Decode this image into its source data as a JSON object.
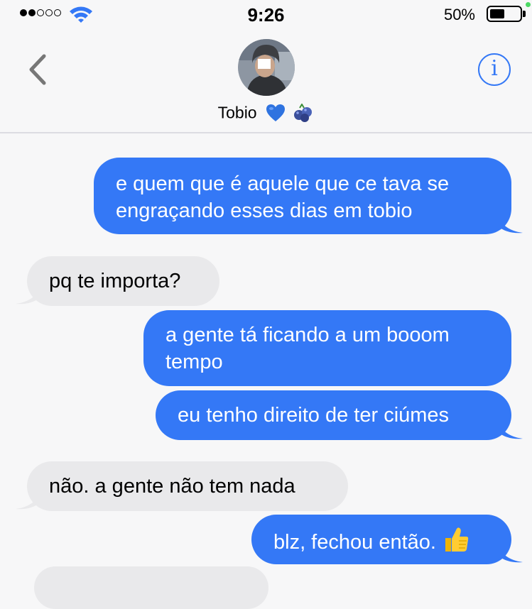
{
  "status_bar": {
    "time": "9:26",
    "battery_percent": "50%",
    "signal_bars": 2,
    "signal_total": 5,
    "battery_level": 0.5
  },
  "header": {
    "contact_name": "Tobio",
    "name_emoji": [
      "blue-heart-icon",
      "blueberries-icon"
    ],
    "back_icon": "chevron-left-icon",
    "info_icon": "info-icon",
    "info_glyph": "i"
  },
  "colors": {
    "sent_bubble": "#3478f6",
    "received_bubble": "#e9e9eb",
    "accent": "#3478f6",
    "background": "#f7f7f8"
  },
  "messages": [
    {
      "direction": "sent",
      "lines": [
        "e quem que é aquele que ce tava se",
        "engraçando esses dias em tobio"
      ]
    },
    {
      "direction": "received",
      "lines": [
        "pq te importa?"
      ]
    },
    {
      "direction": "sent",
      "lines": [
        "a gente tá ficando a um booom",
        "tempo"
      ]
    },
    {
      "direction": "sent",
      "lines": [
        "eu tenho direito de ter ciúmes"
      ]
    },
    {
      "direction": "received",
      "lines": [
        "não. a gente não tem nada"
      ]
    },
    {
      "direction": "sent",
      "lines": [
        "blz, fechou então."
      ],
      "trailing_emoji": "thumbs-up-icon"
    }
  ]
}
